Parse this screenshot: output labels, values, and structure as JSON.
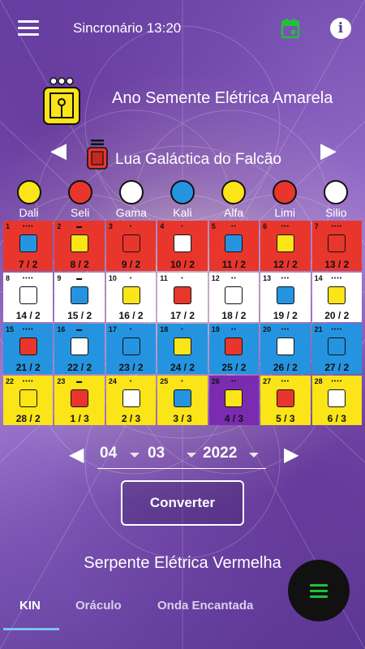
{
  "app": {
    "title": "Sincronário 13:20"
  },
  "icons": {
    "menu": "menu-icon",
    "calendar": "calendar-icon",
    "info": "info-icon",
    "info_glyph": "i",
    "prev": "chevron-left-icon",
    "next": "chevron-right-icon",
    "fab": "menu-icon"
  },
  "year": {
    "title": "Ano Semente Elétrica Amarela"
  },
  "moon": {
    "title": "Lua Galáctica do Falcão",
    "prev_glyph": "◀",
    "next_glyph": "▶"
  },
  "plasmas": [
    {
      "label": "Dali",
      "color": "#fbe417"
    },
    {
      "label": "Seli",
      "color": "#e8362d"
    },
    {
      "label": "Gama",
      "color": "#ffffff"
    },
    {
      "label": "Kali",
      "color": "#2594e0"
    },
    {
      "label": "Alfa",
      "color": "#fbe417"
    },
    {
      "label": "Limi",
      "color": "#e8362d"
    },
    {
      "label": "Silio",
      "color": "#ffffff"
    }
  ],
  "days": [
    {
      "day": "1",
      "kin": "7 / 2",
      "color": "red"
    },
    {
      "day": "2",
      "kin": "8 / 2",
      "color": "red"
    },
    {
      "day": "3",
      "kin": "9 / 2",
      "color": "red"
    },
    {
      "day": "4",
      "kin": "10 / 2",
      "color": "red"
    },
    {
      "day": "5",
      "kin": "11 / 2",
      "color": "red"
    },
    {
      "day": "6",
      "kin": "12 / 2",
      "color": "red"
    },
    {
      "day": "7",
      "kin": "13 / 2",
      "color": "red"
    },
    {
      "day": "8",
      "kin": "14 / 2",
      "color": "white"
    },
    {
      "day": "9",
      "kin": "15 / 2",
      "color": "white"
    },
    {
      "day": "10",
      "kin": "16 / 2",
      "color": "white"
    },
    {
      "day": "11",
      "kin": "17 / 2",
      "color": "white"
    },
    {
      "day": "12",
      "kin": "18 / 2",
      "color": "white"
    },
    {
      "day": "13",
      "kin": "19 / 2",
      "color": "white"
    },
    {
      "day": "14",
      "kin": "20 / 2",
      "color": "white"
    },
    {
      "day": "15",
      "kin": "21 / 2",
      "color": "blue"
    },
    {
      "day": "16",
      "kin": "22 / 2",
      "color": "blue"
    },
    {
      "day": "17",
      "kin": "23 / 2",
      "color": "blue"
    },
    {
      "day": "18",
      "kin": "24 / 2",
      "color": "blue"
    },
    {
      "day": "19",
      "kin": "25 / 2",
      "color": "blue"
    },
    {
      "day": "20",
      "kin": "26 / 2",
      "color": "blue"
    },
    {
      "day": "21",
      "kin": "27 / 2",
      "color": "blue"
    },
    {
      "day": "22",
      "kin": "28 / 2",
      "color": "yellow"
    },
    {
      "day": "23",
      "kin": "1 / 3",
      "color": "yellow"
    },
    {
      "day": "24",
      "kin": "2 / 3",
      "color": "yellow"
    },
    {
      "day": "25",
      "kin": "3 / 3",
      "color": "yellow"
    },
    {
      "day": "26",
      "kin": "4 / 3",
      "color": "purple"
    },
    {
      "day": "27",
      "kin": "5 / 3",
      "color": "yellow"
    },
    {
      "day": "28",
      "kin": "6 / 3",
      "color": "yellow"
    }
  ],
  "date": {
    "day": "04",
    "month": "03",
    "year": "2022",
    "prev_glyph": "◀",
    "next_glyph": "▶"
  },
  "convert_button": "Converter",
  "result": "Serpente Elétrica Vermelha",
  "tabs": [
    {
      "label": "KIN",
      "selected": true
    },
    {
      "label": "Oráculo",
      "selected": false
    },
    {
      "label": "Onda Encantada",
      "selected": false
    }
  ]
}
